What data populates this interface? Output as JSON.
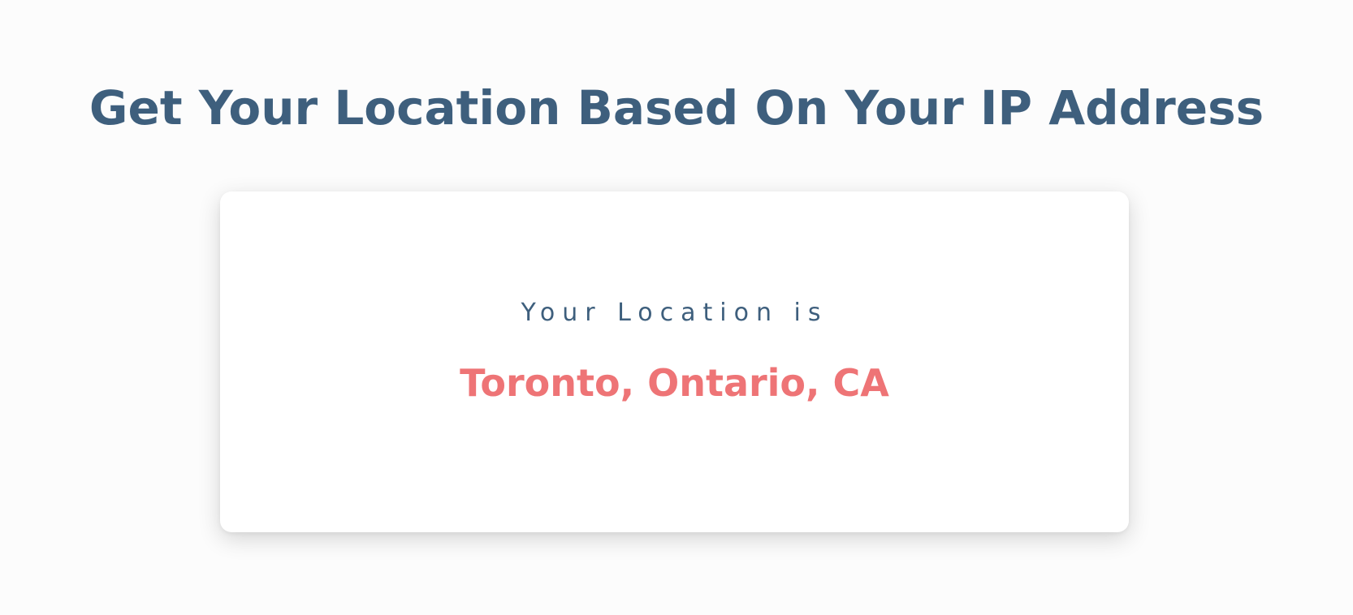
{
  "header": {
    "title": "Get Your Location Based On Your IP Address"
  },
  "card": {
    "label": "Your Location is",
    "location": "Toronto, Ontario, CA"
  },
  "colors": {
    "background": "#fcfcfc",
    "title": "#3e5f7d",
    "label": "#3e5f7d",
    "location": "#ee7476",
    "card": "#ffffff"
  }
}
